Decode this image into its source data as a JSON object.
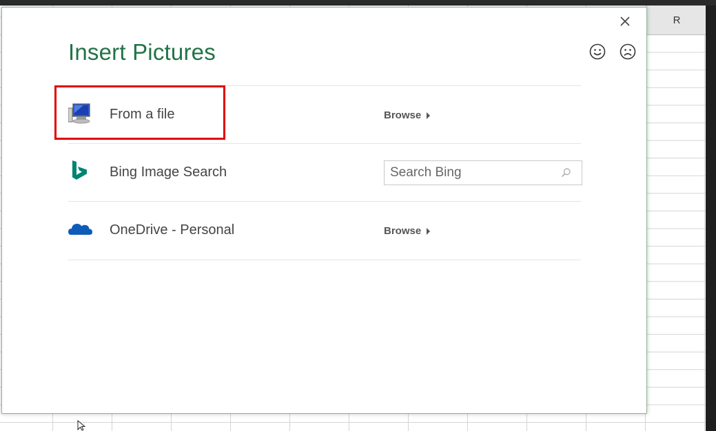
{
  "spreadsheet": {
    "visible_column_header": "R"
  },
  "dialog": {
    "title": "Insert Pictures",
    "close_glyph": "✕",
    "feedback": {
      "smile_icon": "smile-icon",
      "frown_icon": "frown-icon"
    },
    "sources": [
      {
        "label": "From a file",
        "icon": "computer-icon",
        "action": "browse",
        "browse_label": "Browse"
      },
      {
        "label": "Bing Image Search",
        "icon": "bing-icon",
        "action": "search",
        "search_placeholder": "Search Bing",
        "search_value": ""
      },
      {
        "label": "OneDrive - Personal",
        "icon": "onedrive-cloud-icon",
        "action": "browse",
        "browse_label": "Browse"
      }
    ]
  },
  "colors": {
    "title_green": "#217346",
    "highlight_red": "#e00000",
    "bing_teal": "#008373",
    "onedrive_blue": "#0f5cb8"
  }
}
